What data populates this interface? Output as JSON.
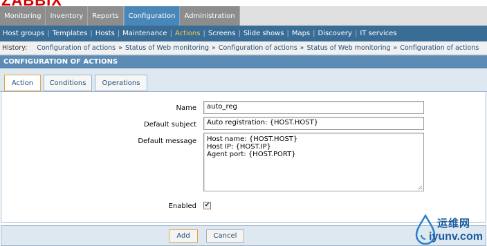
{
  "logo": {
    "text": "ZABBIX"
  },
  "main_menu": {
    "items": [
      {
        "label": "Monitoring"
      },
      {
        "label": "Inventory"
      },
      {
        "label": "Reports"
      },
      {
        "label": "Configuration",
        "active": true
      },
      {
        "label": "Administration"
      }
    ]
  },
  "sub_menu": {
    "items": [
      {
        "label": "Host groups"
      },
      {
        "label": "Templates"
      },
      {
        "label": "Hosts"
      },
      {
        "label": "Maintenance"
      },
      {
        "label": "Actions",
        "active": true
      },
      {
        "label": "Screens"
      },
      {
        "label": "Slide shows"
      },
      {
        "label": "Maps"
      },
      {
        "label": "Discovery"
      },
      {
        "label": "IT services"
      }
    ]
  },
  "history": {
    "label": "History:",
    "links": [
      "Configuration of actions",
      "Status of Web monitoring",
      "Configuration of actions",
      "Status of Web monitoring",
      "Configuration of actions"
    ],
    "separator": "»"
  },
  "section": {
    "title": "CONFIGURATION OF ACTIONS"
  },
  "tabs": {
    "action": "Action",
    "conditions": "Conditions",
    "operations": "Operations"
  },
  "form": {
    "name_label": "Name",
    "name_value": "auto_reg",
    "subject_label": "Default subject",
    "subject_value": "Auto registration: {HOST.HOST}",
    "message_label": "Default message",
    "message_lines": [
      "Host name: {HOST.HOST}",
      "Host IP: {HOST.IP}",
      "Agent port: {HOST.PORT}"
    ],
    "enabled_label": "Enabled",
    "enabled_checked": true
  },
  "buttons": {
    "add": "Add",
    "cancel": "Cancel"
  },
  "watermark": {
    "top": "运维网",
    "bottom": "iyunv.com"
  },
  "colors": {
    "active_tab": "#4a87b9",
    "sub_menu_bg": "#3a6d96",
    "active_sub_item": "#f3c94a",
    "section_header": "#5c8cb6"
  }
}
